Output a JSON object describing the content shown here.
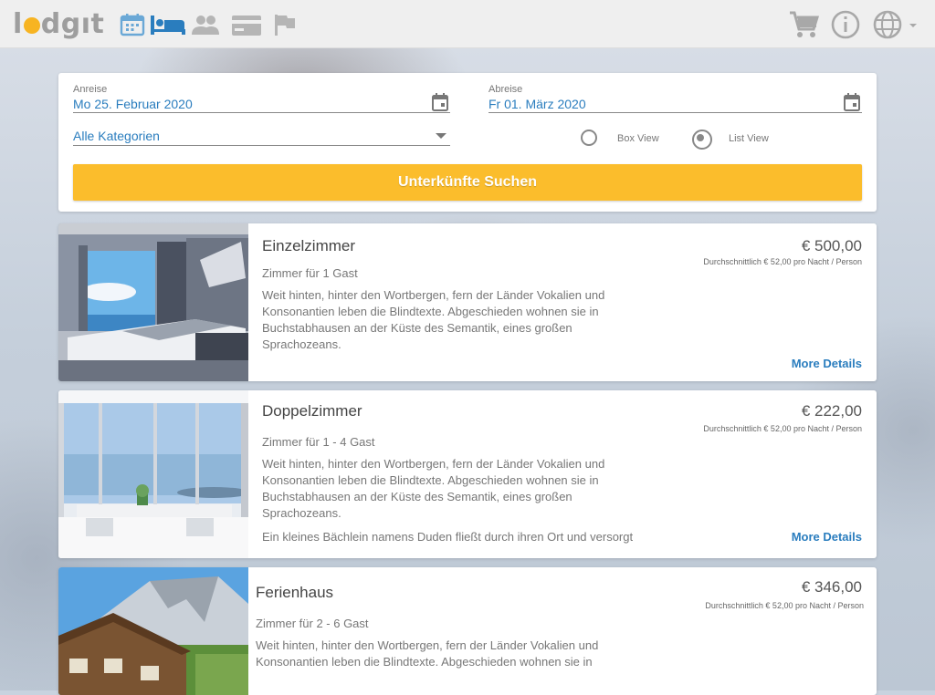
{
  "app": {
    "logo_text_before": "l",
    "logo_text_after": "dgıt",
    "brand_color": "#f7b422",
    "accent_color": "#2a7dbe"
  },
  "nav_icons": [
    "calendar-icon",
    "bed-icon",
    "guests-icon",
    "payment-card-icon",
    "flag-icon"
  ],
  "header_right_icons": [
    "cart-icon",
    "info-icon",
    "language-globe-icon"
  ],
  "search": {
    "arrival_label": "Anreise",
    "arrival_value": "Mo 25. Februar 2020",
    "departure_label": "Abreise",
    "departure_value": "Fr 01. März 2020",
    "category_value": "Alle Kategorien",
    "view_box_label": "Box View",
    "view_list_label": "List View",
    "selected_view": "List View",
    "button_label": "Unterkünfte Suchen"
  },
  "rooms": [
    {
      "title": "Einzelzimmer",
      "guests": "Zimmer für 1 Gast",
      "description": "Weit hinten, hinter den Wortbergen, fern der Länder Vokalien und Konsonantien leben die Blindtexte. Abgeschieden wohnen sie in Buchstabhausen an der Küste des Semantik, eines großen Sprachozeans.",
      "extra": "",
      "price": "€ 500,00",
      "avg": "Durchschnittlich € 52,00 pro Nacht / Person",
      "more": "More Details"
    },
    {
      "title": "Doppelzimmer",
      "guests": "Zimmer für 1 - 4 Gast",
      "description": "Weit hinten, hinter den Wortbergen, fern der Länder Vokalien und Konsonantien leben die Blindtexte. Abgeschieden wohnen sie in Buchstabhausen an der Küste des Semantik, eines großen Sprachozeans.",
      "extra": "Ein kleines Bächlein namens Duden fließt durch ihren Ort und versorgt",
      "price": "€ 222,00",
      "avg": "Durchschnittlich € 52,00 pro Nacht / Person",
      "more": "More Details"
    },
    {
      "title": "Ferienhaus",
      "guests": "Zimmer für 2 - 6 Gast",
      "description": "Weit hinten, hinter den Wortbergen, fern der Länder Vokalien und Konsonantien leben die Blindtexte. Abgeschieden wohnen sie in",
      "extra": "",
      "price": "€ 346,00",
      "avg": "Durchschnittlich € 52,00 pro Nacht / Person",
      "more": ""
    }
  ]
}
